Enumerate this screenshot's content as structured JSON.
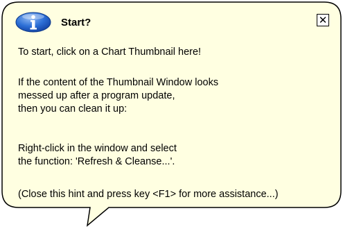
{
  "balloon": {
    "title": "Start?",
    "close_label": "✕",
    "paragraph_1": "To start, click on a Chart Thumbnail here!",
    "paragraph_2": "If the content of the Thumbnail Window looks\nmessed up after a program update,\nthen you can clean it up:",
    "paragraph_3": "Right-click in the window and select\nthe function: 'Refresh & Cleanse...'.",
    "paragraph_4": "(Close this hint and press key <F1> for more assistance...)"
  },
  "icons": {
    "info": "info-icon",
    "close": "close-icon"
  },
  "colors": {
    "balloon_background": "#FFFFE1",
    "balloon_border": "#000000",
    "icon_blue": "#1C5FC7",
    "text": "#000000"
  }
}
